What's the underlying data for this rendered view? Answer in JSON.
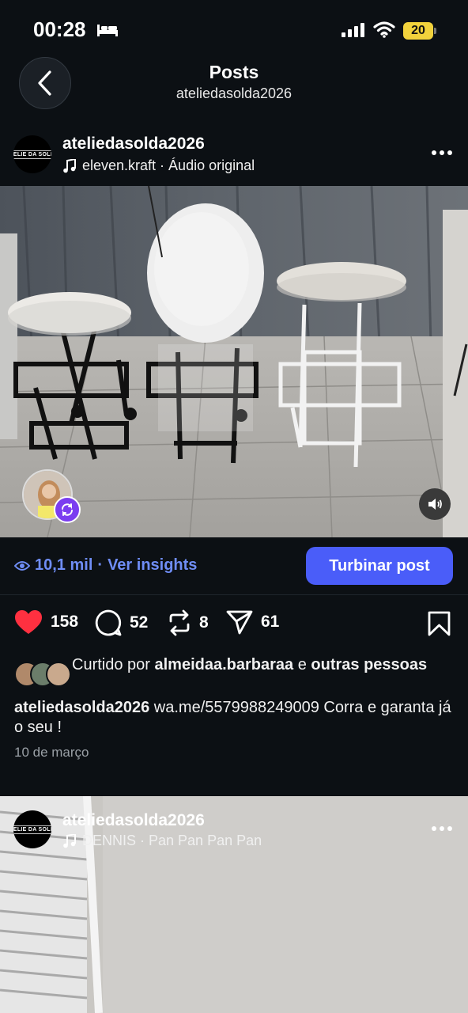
{
  "status_bar": {
    "time": "00:28",
    "battery": "20"
  },
  "header": {
    "title": "Posts",
    "subtitle": "ateliedasolda2026"
  },
  "post1": {
    "username": "ateliedasolda2026",
    "avatar_text": "ATELIE DA SOLDA",
    "audio": "eleven.kraft · Áudio original",
    "insights_views": "10,1 mil",
    "insights_sep": "·",
    "insights_link": "Ver insights",
    "boost_label": "Turbinar post",
    "likes": "158",
    "comments": "52",
    "reposts": "8",
    "shares": "61",
    "liked_prefix": "Curtido por",
    "liked_user": "almeidaa.barbaraa",
    "liked_and": "e",
    "liked_others": "outras pessoas",
    "caption_user": "ateliedasolda2026",
    "caption_text": "wa.me/5579988249009 Corra e garanta já o seu !",
    "date": "10 de março"
  },
  "post2": {
    "username": "ateliedasolda2026",
    "avatar_text": "ATELIE DA SOLDA",
    "audio": "DENNIS · Pan Pan Pan Pan"
  },
  "colors": {
    "accent": "#4a5df9",
    "link": "#6f8df5",
    "like": "#ff3040",
    "background": "#0c1014"
  },
  "icons": [
    "bed-icon",
    "signal-icon",
    "wifi-icon",
    "back-icon",
    "music-icon",
    "more-icon",
    "remix-icon",
    "speaker-icon",
    "eye-icon",
    "heart-icon",
    "comment-icon",
    "repost-icon",
    "share-icon",
    "bookmark-icon"
  ]
}
